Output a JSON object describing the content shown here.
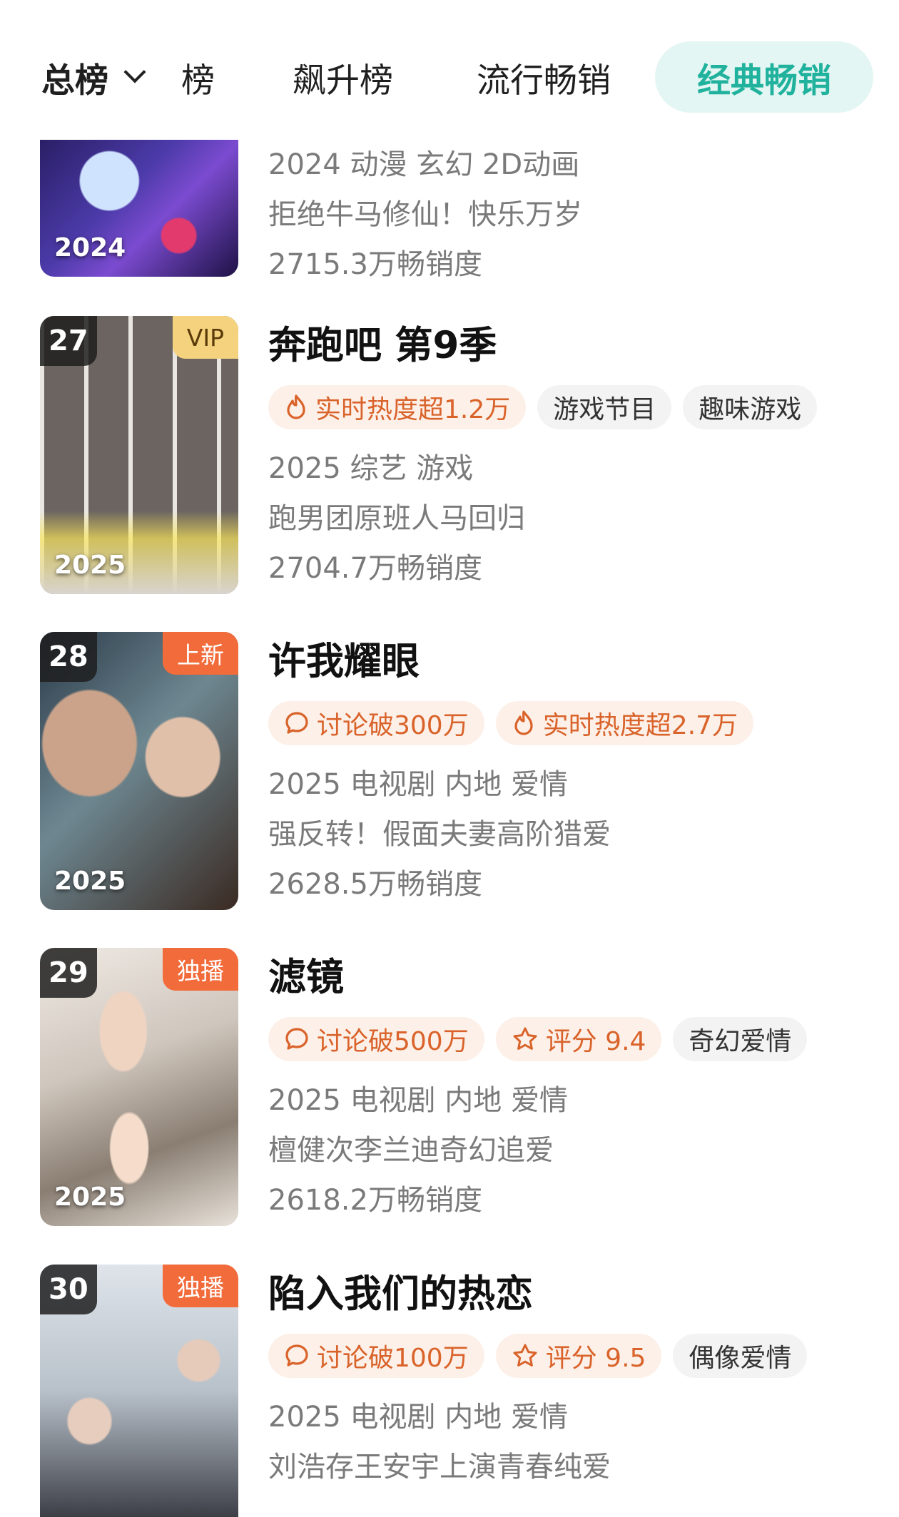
{
  "tabs": {
    "total": "总榜",
    "partial": "榜",
    "rise": "飙升榜",
    "popular": "流行畅销",
    "classic": "经典畅销"
  },
  "items": [
    {
      "year": "2024",
      "genre": "2024 动漫 玄幻 2D动画",
      "desc": "拒绝牛马修仙！快乐万岁",
      "sales": "2715.3万畅销度"
    },
    {
      "rank": "27",
      "badge": "VIP",
      "year": "2025",
      "title": "奔跑吧 第9季",
      "tags": [
        "实时热度超1.2万",
        "游戏节目",
        "趣味游戏"
      ],
      "genre": "2025 综艺 游戏",
      "desc": "跑男团原班人马回归",
      "sales": "2704.7万畅销度"
    },
    {
      "rank": "28",
      "badge": "上新",
      "year": "2025",
      "title": "许我耀眼",
      "tags": [
        "讨论破300万",
        "实时热度超2.7万"
      ],
      "genre": "2025 电视剧 内地 爱情",
      "desc": "强反转！假面夫妻高阶猎爱",
      "sales": "2628.5万畅销度"
    },
    {
      "rank": "29",
      "badge": "独播",
      "year": "2025",
      "title": "滤镜",
      "tags": [
        "讨论破500万",
        "评分 9.4",
        "奇幻爱情"
      ],
      "genre": "2025 电视剧 内地 爱情",
      "desc": "檀健次李兰迪奇幻追爱",
      "sales": "2618.2万畅销度"
    },
    {
      "rank": "30",
      "badge": "独播",
      "title": "陷入我们的热恋",
      "tags": [
        "讨论破100万",
        "评分 9.5",
        "偶像爱情"
      ],
      "genre": "2025 电视剧 内地 爱情",
      "desc": "刘浩存王安宇上演青春纯爱"
    }
  ],
  "colors": {
    "accent": "#20b29d",
    "accent_bg": "#e4f6f3",
    "hot_text": "#d9632a",
    "hot_bg": "#fdf0e8",
    "badge_new": "#f26b3a",
    "badge_vip": "#f4d27e"
  }
}
